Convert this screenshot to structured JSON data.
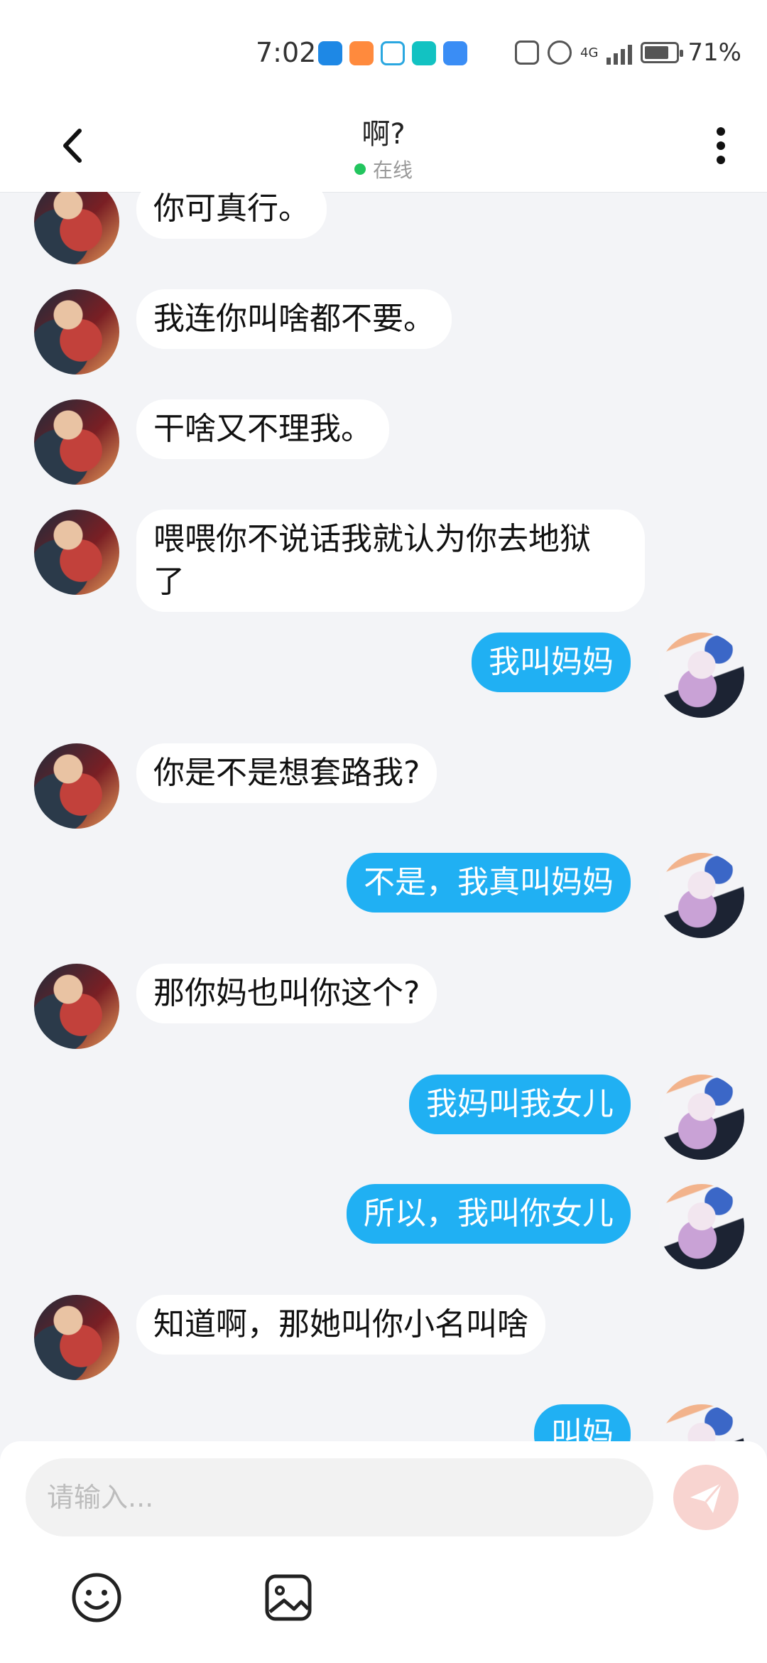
{
  "status_bar": {
    "time": "7:02",
    "battery": "71%",
    "network": "4G"
  },
  "header": {
    "title": "啊?",
    "status": "在线"
  },
  "messages": [
    {
      "side": "left",
      "text": "你可真行。"
    },
    {
      "side": "left",
      "text": "我连你叫啥都不要。"
    },
    {
      "side": "left",
      "text": "干啥又不理我。"
    },
    {
      "side": "left",
      "text": "喂喂你不说话我就认为你去地狱\n了"
    },
    {
      "side": "right",
      "text": "我叫妈妈"
    },
    {
      "side": "left",
      "text": "你是不是想套路我?"
    },
    {
      "side": "right",
      "text": "不是，我真叫妈妈"
    },
    {
      "side": "left",
      "text": "那你妈也叫你这个?"
    },
    {
      "side": "right",
      "text": "我妈叫我女儿"
    },
    {
      "side": "right",
      "text": "所以，我叫你女儿"
    },
    {
      "side": "left",
      "text": "知道啊，那她叫你小名叫啥"
    },
    {
      "side": "right",
      "text": "叫妈"
    }
  ],
  "input": {
    "placeholder": "请输入..."
  },
  "icons": {
    "back": "chevron-left-icon",
    "more": "more-vertical-icon",
    "send": "send-icon",
    "emoji": "emoji-icon",
    "image": "image-icon"
  },
  "colors": {
    "accent": "#20b0f3",
    "online": "#22c55e",
    "send_disabled": "#f8d4d0"
  }
}
